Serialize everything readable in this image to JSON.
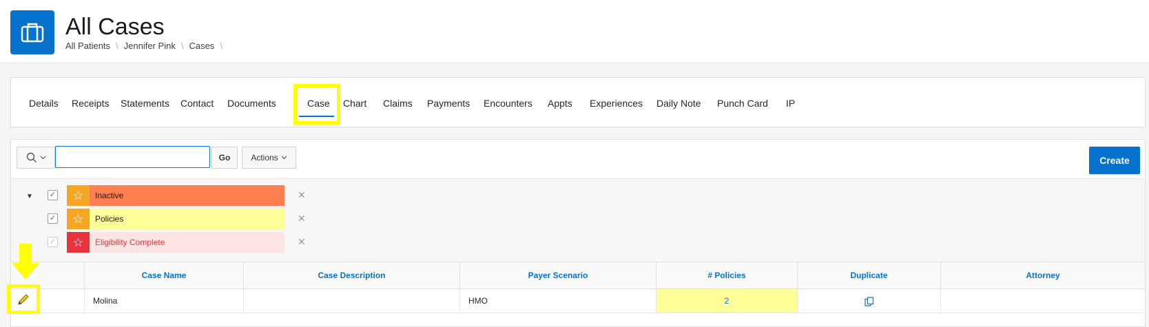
{
  "header": {
    "title": "All Cases",
    "breadcrumbs": [
      "All Patients",
      "Jennifer Pink",
      "Cases"
    ],
    "app_icon": "briefcase-icon"
  },
  "tabs": [
    {
      "label": "Details"
    },
    {
      "label": "Receipts"
    },
    {
      "label": "Statements"
    },
    {
      "label": "Contact"
    },
    {
      "label": "Documents"
    },
    {
      "label": "Case",
      "active": true
    },
    {
      "label": "Chart"
    },
    {
      "label": "Claims"
    },
    {
      "label": "Payments"
    },
    {
      "label": "Encounters"
    },
    {
      "label": "Appts"
    },
    {
      "label": "Experiences"
    },
    {
      "label": "Daily Note"
    },
    {
      "label": "Punch Card"
    },
    {
      "label": "IP"
    }
  ],
  "toolbar": {
    "search_value": "",
    "go_label": "Go",
    "actions_label": "Actions",
    "create_label": "Create"
  },
  "filters": [
    {
      "label": "Inactive",
      "star_color": "#f5a623",
      "label_bg": "#ff7f50",
      "label_color": "#1a1a1a",
      "checked": true,
      "enabled": true
    },
    {
      "label": "Policies",
      "star_color": "#f5a623",
      "label_bg": "#ffff99",
      "label_color": "#1a1a1a",
      "checked": true,
      "enabled": true
    },
    {
      "label": "Eligibility Complete",
      "star_color": "#e8323c",
      "label_bg": "#ffe4e4",
      "label_color": "#d9383f",
      "checked": true,
      "enabled": false
    }
  ],
  "grid": {
    "columns": [
      "Case Name",
      "Case Description",
      "Payer Scenario",
      "# Policies",
      "Duplicate",
      "Attorney"
    ],
    "rows": [
      {
        "case_name": "Molina",
        "case_description": "",
        "payer_scenario": "HMO",
        "policies": "2",
        "duplicate_icon": "duplicate-icon",
        "attorney": ""
      }
    ]
  },
  "colors": {
    "accent": "#0572ce",
    "highlight": "#ffff00"
  }
}
